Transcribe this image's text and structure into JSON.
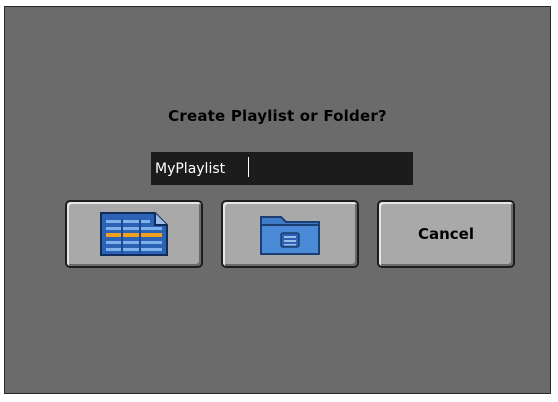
{
  "dialog": {
    "title": "Create Playlist or Folder?",
    "name_input": {
      "value": "MyPlaylist",
      "placeholder": ""
    },
    "buttons": {
      "playlist": {
        "icon": "playlist-icon"
      },
      "folder": {
        "icon": "folder-icon"
      },
      "cancel": {
        "label": "Cancel"
      }
    }
  },
  "colors": {
    "background": "#6b6b6b",
    "input_background": "#1c1c1c",
    "button_face": "#a9a9a9",
    "icon_blue": "#2f6fbf",
    "icon_highlight": "#f0a020"
  }
}
